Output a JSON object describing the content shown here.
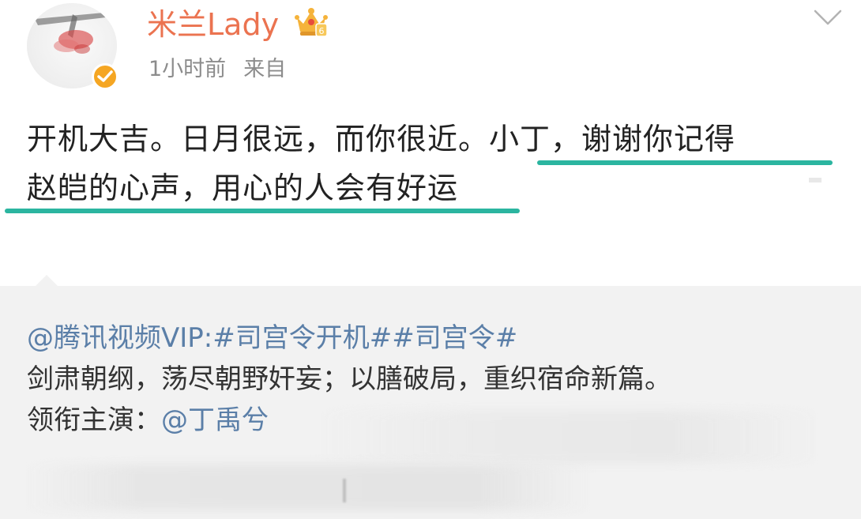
{
  "post": {
    "username": "米兰Lady",
    "time": "1小时前",
    "source_prefix": "来自",
    "content_line1_plain": "开机大吉。日月很远，而你很近。",
    "content_line1_highlight": "小丁，谢谢你记得",
    "content_line2_highlight": "赵皑的心声，用心的人会有好运",
    "highlight_color": "#2bb5a0",
    "username_color": "#eb7350"
  },
  "repost": {
    "mention": "@腾讯视频VIP:",
    "hashtags": "#司宫令开机##司宫令#",
    "line2": "剑肃朝纲，荡尽朝野奸妄；以膳破局，重织宿命新篇。",
    "line3_prefix": "领衔主演：",
    "line3_mention": "@丁禹兮",
    "link_color": "#5b7fa8"
  },
  "icons": {
    "crown": "crown-vip-icon",
    "verified": "verified-badge-icon",
    "chevron": "chevron-down-icon"
  }
}
